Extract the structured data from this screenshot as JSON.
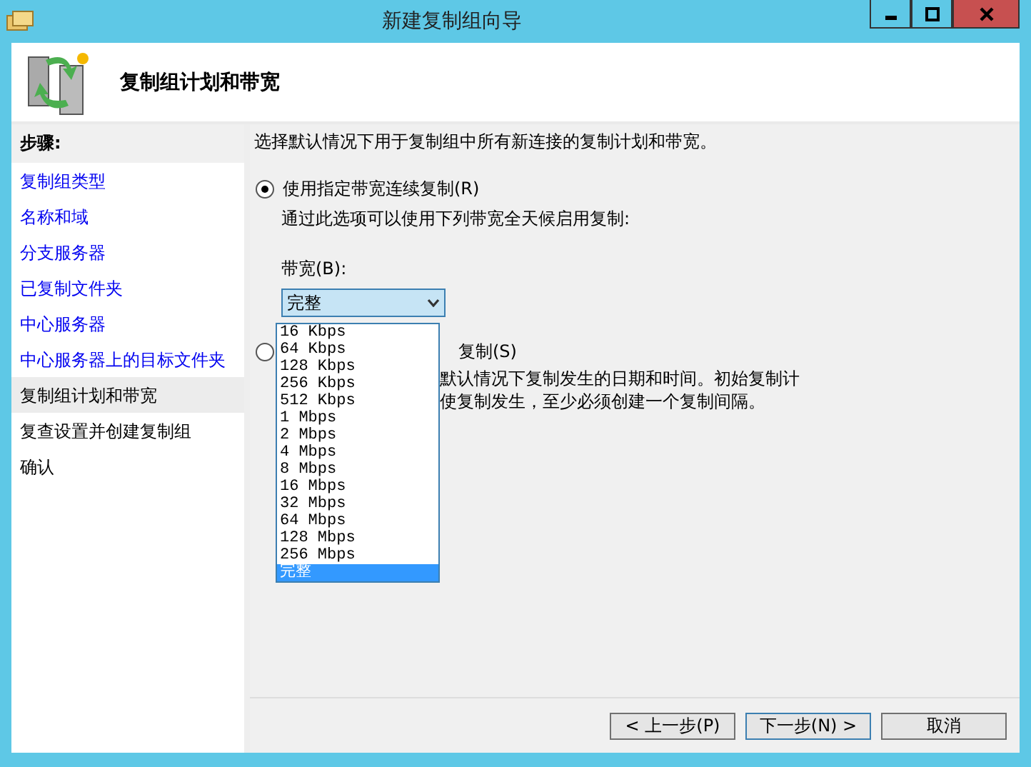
{
  "window": {
    "title": "新建复制组向导"
  },
  "header": {
    "title": "复制组计划和带宽"
  },
  "sidebar": {
    "heading": "步骤:",
    "items": [
      {
        "label": "复制组类型",
        "visited": true,
        "selected": false
      },
      {
        "label": "名称和域",
        "visited": true,
        "selected": false
      },
      {
        "label": "分支服务器",
        "visited": true,
        "selected": false
      },
      {
        "label": "已复制文件夹",
        "visited": true,
        "selected": false
      },
      {
        "label": "中心服务器",
        "visited": true,
        "selected": false
      },
      {
        "label": "中心服务器上的目标文件夹",
        "visited": true,
        "selected": false
      },
      {
        "label": "复制组计划和带宽",
        "visited": false,
        "selected": true
      },
      {
        "label": "复查设置并创建复制组",
        "visited": false,
        "selected": false
      },
      {
        "label": "确认",
        "visited": false,
        "selected": false
      }
    ]
  },
  "content": {
    "intro": "选择默认情况下用于复制组中所有新连接的复制计划和带宽。",
    "options": [
      {
        "label": "使用指定带宽连续复制(R)",
        "selected": true,
        "description": [
          "通过此选项可以使用下列带宽全天候启用复制:"
        ]
      },
      {
        "label": "复制(S)",
        "selected": false,
        "description": [
          "默认情况下复制发生的日期和时间。初始复制计",
          "使复制发生，至少必须创建一个复制间隔。"
        ]
      }
    ],
    "bandwidth": {
      "label": "带宽(B):",
      "value": "完整",
      "options": [
        {
          "label": "16 Kbps",
          "selected": false
        },
        {
          "label": "64 Kbps",
          "selected": false
        },
        {
          "label": "128 Kbps",
          "selected": false
        },
        {
          "label": "256 Kbps",
          "selected": false
        },
        {
          "label": "512 Kbps",
          "selected": false
        },
        {
          "label": "1 Mbps",
          "selected": false
        },
        {
          "label": "2 Mbps",
          "selected": false
        },
        {
          "label": "4 Mbps",
          "selected": false
        },
        {
          "label": "8 Mbps",
          "selected": false
        },
        {
          "label": "16 Mbps",
          "selected": false
        },
        {
          "label": "32 Mbps",
          "selected": false
        },
        {
          "label": "64 Mbps",
          "selected": false
        },
        {
          "label": "128 Mbps",
          "selected": false
        },
        {
          "label": "256 Mbps",
          "selected": false
        },
        {
          "label": "完整",
          "selected": true
        }
      ]
    }
  },
  "buttons": [
    "< 上一步(P)",
    "下一步(N) >",
    "取消"
  ]
}
